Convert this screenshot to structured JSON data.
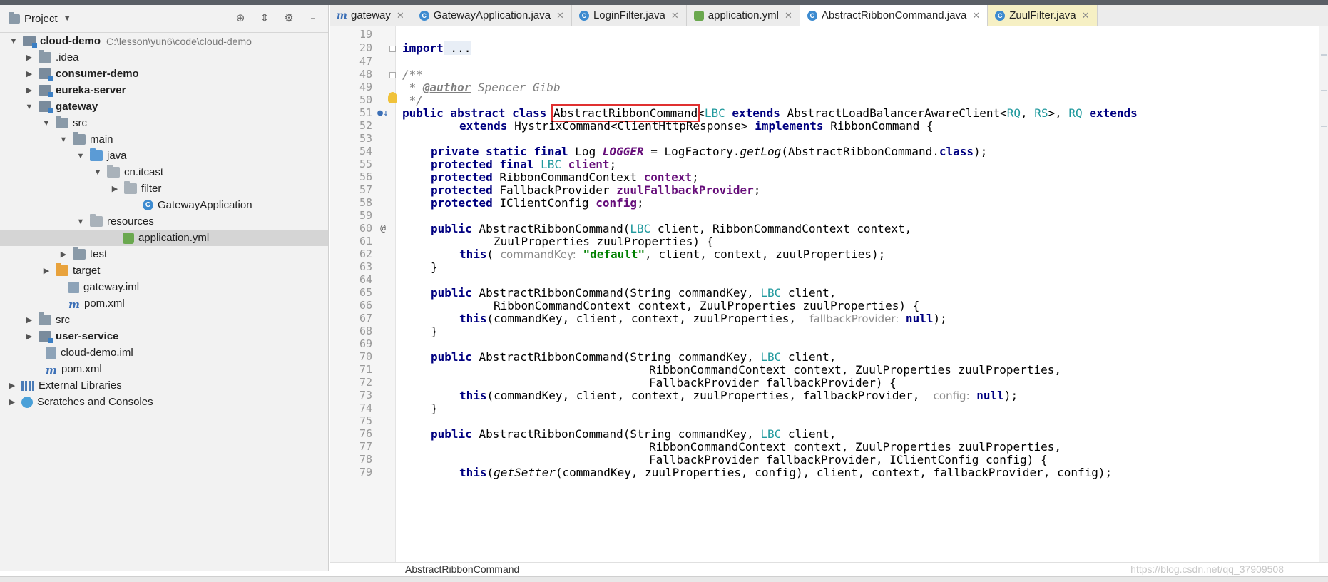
{
  "project_panel": {
    "title": "Project",
    "tree": [
      {
        "label": "cloud-demo",
        "path": "C:\\lesson\\yun6\\code\\cloud-demo"
      },
      {
        "label": ".idea"
      },
      {
        "label": "consumer-demo"
      },
      {
        "label": "eureka-server"
      },
      {
        "label": "gateway"
      },
      {
        "label": "src"
      },
      {
        "label": "main"
      },
      {
        "label": "java"
      },
      {
        "label": "cn.itcast"
      },
      {
        "label": "filter"
      },
      {
        "label": "GatewayApplication"
      },
      {
        "label": "resources"
      },
      {
        "label": "application.yml"
      },
      {
        "label": "test"
      },
      {
        "label": "target"
      },
      {
        "label": "gateway.iml"
      },
      {
        "label": "pom.xml"
      },
      {
        "label": "src"
      },
      {
        "label": "user-service"
      },
      {
        "label": "cloud-demo.iml"
      },
      {
        "label": "pom.xml"
      },
      {
        "label": "External Libraries"
      },
      {
        "label": "Scratches and Consoles"
      }
    ]
  },
  "tabs": [
    {
      "label": "gateway"
    },
    {
      "label": "GatewayApplication.java"
    },
    {
      "label": "LoginFilter.java"
    },
    {
      "label": "application.yml"
    },
    {
      "label": "AbstractRibbonCommand.java"
    },
    {
      "label": "ZuulFilter.java"
    }
  ],
  "editor": {
    "line_numbers": [
      "19",
      "20",
      "47",
      "48",
      "49",
      "50",
      "51",
      "52",
      "53",
      "54",
      "55",
      "56",
      "57",
      "58",
      "59",
      "60",
      "61",
      "62",
      "63",
      "64",
      "65",
      "66",
      "67",
      "68",
      "69",
      "70",
      "71",
      "72",
      "73",
      "74",
      "75",
      "76",
      "77",
      "78",
      "79"
    ],
    "breadcrumb": "AbstractRibbonCommand",
    "watermark": "https://blog.csdn.net/qq_37909508",
    "code": {
      "l20_kw": "import",
      "l20_rest": " ...",
      "l48": "/**",
      "l49_a": " * ",
      "l49_tag": "@author",
      "l49_b": " Spencer Gibb",
      "l50": " */",
      "l51_kw": "public abstract class ",
      "l51_name": "AbstractRibbonCommand",
      "l51_lt": "<",
      "l51_lbc": "LBC",
      "l51_ext": " extends ",
      "l51_base": "AbstractLoadBalancerAwareClient<",
      "l51_rq": "RQ",
      "l51_comma": ", ",
      "l51_rs": "RS",
      "l51_gt": ">, ",
      "l51_rq2": "RQ",
      "l51_ext2": " extends",
      "l52_ext": "extends ",
      "l52_mid": "HystrixCommand<ClientHttpResponse> ",
      "l52_impl": "implements ",
      "l52_end": "RibbonCommand {",
      "l54_kw": "private static final ",
      "l54_type": "Log ",
      "l54_fld": "LOGGER",
      "l54_eq": " = LogFactory.",
      "l54_m": "getLog",
      "l54_arg": "(AbstractRibbonCommand.",
      "l54_cls": "class",
      "l54_end": ");",
      "l55_kw": "protected final ",
      "l55_t": "LBC",
      "l55_fld": " client",
      "l55_end": ";",
      "l56_kw": "protected ",
      "l56_t": "RibbonCommandContext ",
      "l56_fld": "context",
      "l56_end": ";",
      "l57_kw": "protected ",
      "l57_t": "FallbackProvider ",
      "l57_fld": "zuulFallbackProvider",
      "l57_end": ";",
      "l58_kw": "protected ",
      "l58_t": "IClientConfig ",
      "l58_fld": "config",
      "l58_end": ";",
      "l60_kw": "public ",
      "l60_a": "AbstractRibbonCommand(",
      "l60_lbc": "LBC",
      "l60_b": " client, RibbonCommandContext context,",
      "l61": "ZuulProperties zuulProperties) {",
      "l62_kw": "this",
      "l62_a": "( ",
      "l62_hint": "commandKey:",
      "l62_str": " \"default\"",
      "l62_b": ", client, context, zuulProperties);",
      "l63": "}",
      "l65_kw": "public ",
      "l65_a": "AbstractRibbonCommand(String commandKey, ",
      "l65_lbc": "LBC",
      "l65_b": " client,",
      "l66": "RibbonCommandContext context, ZuulProperties zuulProperties) {",
      "l67_kw": "this",
      "l67_a": "(commandKey, client, context, zuulProperties,  ",
      "l67_hint": "fallbackProvider:",
      "l67_null": " null",
      "l67_end": ");",
      "l68": "}",
      "l70_kw": "public ",
      "l70_a": "AbstractRibbonCommand(String commandKey, ",
      "l70_lbc": "LBC",
      "l70_b": " client,",
      "l71": "RibbonCommandContext context, ZuulProperties zuulProperties,",
      "l72": "FallbackProvider fallbackProvider) {",
      "l73_kw": "this",
      "l73_a": "(commandKey, client, context, zuulProperties, fallbackProvider,  ",
      "l73_hint": "config:",
      "l73_null": " null",
      "l73_end": ");",
      "l74": "}",
      "l76_kw": "public ",
      "l76_a": "AbstractRibbonCommand(String commandKey, ",
      "l76_lbc": "LBC",
      "l76_b": " client,",
      "l77": "RibbonCommandContext context, ZuulProperties zuulProperties,",
      "l78": "FallbackProvider fallbackProvider, IClientConfig config) {",
      "l79_kw": "this",
      "l79_a": "(",
      "l79_m": "getSetter",
      "l79_b": "(commandKey, zuulProperties, config), client, context, fallbackProvider, config);"
    }
  }
}
